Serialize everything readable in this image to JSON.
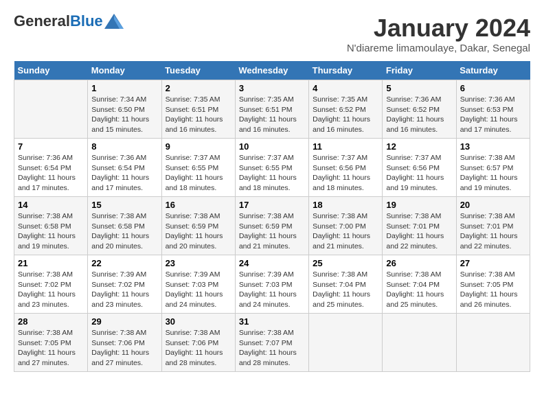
{
  "header": {
    "logo_general": "General",
    "logo_blue": "Blue",
    "month_title": "January 2024",
    "location": "N'diareme limamoulaye, Dakar, Senegal"
  },
  "days_of_week": [
    "Sunday",
    "Monday",
    "Tuesday",
    "Wednesday",
    "Thursday",
    "Friday",
    "Saturday"
  ],
  "weeks": [
    [
      {
        "day": "",
        "info": ""
      },
      {
        "day": "1",
        "info": "Sunrise: 7:34 AM\nSunset: 6:50 PM\nDaylight: 11 hours\nand 15 minutes."
      },
      {
        "day": "2",
        "info": "Sunrise: 7:35 AM\nSunset: 6:51 PM\nDaylight: 11 hours\nand 16 minutes."
      },
      {
        "day": "3",
        "info": "Sunrise: 7:35 AM\nSunset: 6:51 PM\nDaylight: 11 hours\nand 16 minutes."
      },
      {
        "day": "4",
        "info": "Sunrise: 7:35 AM\nSunset: 6:52 PM\nDaylight: 11 hours\nand 16 minutes."
      },
      {
        "day": "5",
        "info": "Sunrise: 7:36 AM\nSunset: 6:52 PM\nDaylight: 11 hours\nand 16 minutes."
      },
      {
        "day": "6",
        "info": "Sunrise: 7:36 AM\nSunset: 6:53 PM\nDaylight: 11 hours\nand 17 minutes."
      }
    ],
    [
      {
        "day": "7",
        "info": "Sunrise: 7:36 AM\nSunset: 6:54 PM\nDaylight: 11 hours\nand 17 minutes."
      },
      {
        "day": "8",
        "info": "Sunrise: 7:36 AM\nSunset: 6:54 PM\nDaylight: 11 hours\nand 17 minutes."
      },
      {
        "day": "9",
        "info": "Sunrise: 7:37 AM\nSunset: 6:55 PM\nDaylight: 11 hours\nand 18 minutes."
      },
      {
        "day": "10",
        "info": "Sunrise: 7:37 AM\nSunset: 6:55 PM\nDaylight: 11 hours\nand 18 minutes."
      },
      {
        "day": "11",
        "info": "Sunrise: 7:37 AM\nSunset: 6:56 PM\nDaylight: 11 hours\nand 18 minutes."
      },
      {
        "day": "12",
        "info": "Sunrise: 7:37 AM\nSunset: 6:56 PM\nDaylight: 11 hours\nand 19 minutes."
      },
      {
        "day": "13",
        "info": "Sunrise: 7:38 AM\nSunset: 6:57 PM\nDaylight: 11 hours\nand 19 minutes."
      }
    ],
    [
      {
        "day": "14",
        "info": "Sunrise: 7:38 AM\nSunset: 6:58 PM\nDaylight: 11 hours\nand 19 minutes."
      },
      {
        "day": "15",
        "info": "Sunrise: 7:38 AM\nSunset: 6:58 PM\nDaylight: 11 hours\nand 20 minutes."
      },
      {
        "day": "16",
        "info": "Sunrise: 7:38 AM\nSunset: 6:59 PM\nDaylight: 11 hours\nand 20 minutes."
      },
      {
        "day": "17",
        "info": "Sunrise: 7:38 AM\nSunset: 6:59 PM\nDaylight: 11 hours\nand 21 minutes."
      },
      {
        "day": "18",
        "info": "Sunrise: 7:38 AM\nSunset: 7:00 PM\nDaylight: 11 hours\nand 21 minutes."
      },
      {
        "day": "19",
        "info": "Sunrise: 7:38 AM\nSunset: 7:01 PM\nDaylight: 11 hours\nand 22 minutes."
      },
      {
        "day": "20",
        "info": "Sunrise: 7:38 AM\nSunset: 7:01 PM\nDaylight: 11 hours\nand 22 minutes."
      }
    ],
    [
      {
        "day": "21",
        "info": "Sunrise: 7:38 AM\nSunset: 7:02 PM\nDaylight: 11 hours\nand 23 minutes."
      },
      {
        "day": "22",
        "info": "Sunrise: 7:39 AM\nSunset: 7:02 PM\nDaylight: 11 hours\nand 23 minutes."
      },
      {
        "day": "23",
        "info": "Sunrise: 7:39 AM\nSunset: 7:03 PM\nDaylight: 11 hours\nand 24 minutes."
      },
      {
        "day": "24",
        "info": "Sunrise: 7:39 AM\nSunset: 7:03 PM\nDaylight: 11 hours\nand 24 minutes."
      },
      {
        "day": "25",
        "info": "Sunrise: 7:38 AM\nSunset: 7:04 PM\nDaylight: 11 hours\nand 25 minutes."
      },
      {
        "day": "26",
        "info": "Sunrise: 7:38 AM\nSunset: 7:04 PM\nDaylight: 11 hours\nand 25 minutes."
      },
      {
        "day": "27",
        "info": "Sunrise: 7:38 AM\nSunset: 7:05 PM\nDaylight: 11 hours\nand 26 minutes."
      }
    ],
    [
      {
        "day": "28",
        "info": "Sunrise: 7:38 AM\nSunset: 7:05 PM\nDaylight: 11 hours\nand 27 minutes."
      },
      {
        "day": "29",
        "info": "Sunrise: 7:38 AM\nSunset: 7:06 PM\nDaylight: 11 hours\nand 27 minutes."
      },
      {
        "day": "30",
        "info": "Sunrise: 7:38 AM\nSunset: 7:06 PM\nDaylight: 11 hours\nand 28 minutes."
      },
      {
        "day": "31",
        "info": "Sunrise: 7:38 AM\nSunset: 7:07 PM\nDaylight: 11 hours\nand 28 minutes."
      },
      {
        "day": "",
        "info": ""
      },
      {
        "day": "",
        "info": ""
      },
      {
        "day": "",
        "info": ""
      }
    ]
  ]
}
